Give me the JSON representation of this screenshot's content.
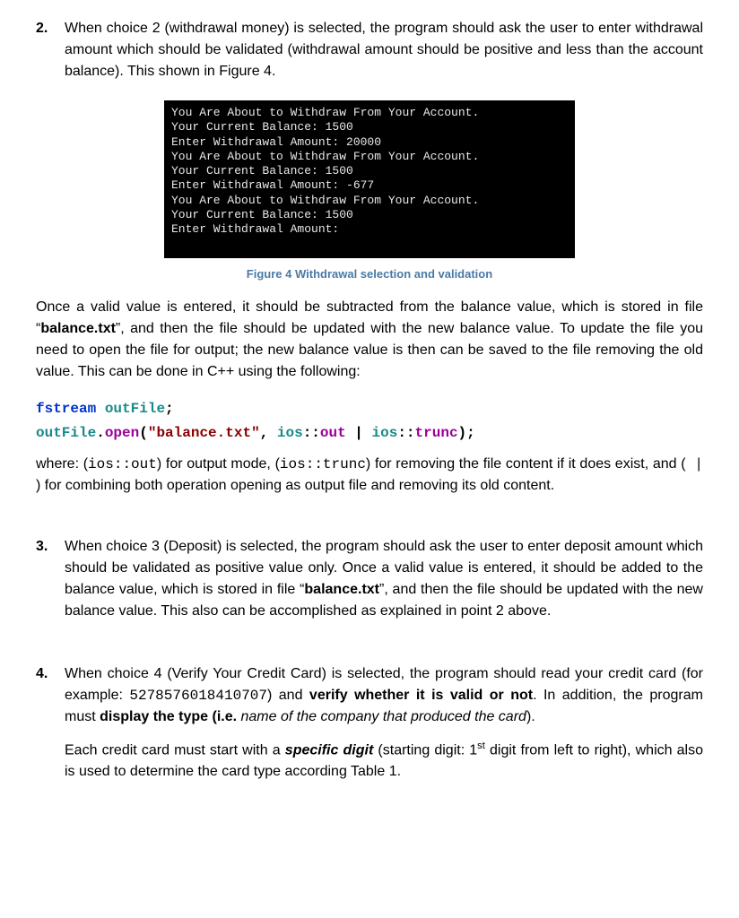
{
  "item2": {
    "num": "2.",
    "text": "When choice 2 (withdrawal money) is selected, the program should ask the user to enter withdrawal amount which should be validated (withdrawal amount should be positive and less than the account balance). This shown in Figure 4."
  },
  "terminal": {
    "l1": "You Are About to Withdraw From Your Account.",
    "l2": "Your Current Balance: 1500",
    "l3": "Enter Withdrawal Amount: 20000",
    "l4": "You Are About to Withdraw From Your Account.",
    "l5": "Your Current Balance: 1500",
    "l6": "Enter Withdrawal Amount: -677",
    "l7": "You Are About to Withdraw From Your Account.",
    "l8": "Your Current Balance: 1500",
    "l9": "Enter Withdrawal Amount:"
  },
  "figcap": "Figure 4 Withdrawal selection and validation",
  "para_once": {
    "a": "Once a valid value is entered, it should be subtracted from the balance value, which is stored in file “",
    "b_bold": "balance.txt",
    "c": "”, and then the file should be updated with the new balance value. To update the file you need to open the file for output; the new balance value is then can be saved to the file removing the old value. This can be done in C++ using the following:"
  },
  "code": {
    "l1": {
      "a": "fstream",
      "b": " ",
      "c": "outFile",
      "d": ";"
    },
    "l2": {
      "a": "outFile",
      "b": ".",
      "c": "open",
      "d": "(",
      "e": "\"balance.txt\"",
      "f": ", ",
      "g": "ios",
      "h": "::",
      "i": "out",
      "j": " | ",
      "k": "ios",
      "l": "::",
      "m": "trunc",
      "n": ");"
    }
  },
  "para_where": {
    "a": "where: (",
    "b_mono": "ios::out",
    "c": ") for output mode, (",
    "d_mono": "ios::trunc",
    "e": ") for removing the file content if it does exist, and (",
    "f_mono": " | ",
    "g": ") for combining both operation opening as output file and removing its old content."
  },
  "item3": {
    "num": "3.",
    "a": "When choice 3 (Deposit) is selected, the program should ask the user to enter deposit amount which should be validated as positive value only. Once a valid value is entered, it should be added to the balance value, which is stored in file “",
    "b_bold": "balance.txt",
    "c": "”, and then the file should be updated with the new balance value. This also can be accomplished as explained in point 2 above."
  },
  "item4": {
    "num": "4.",
    "p1": {
      "a": "When choice 4 (Verify Your Credit Card) is selected, the program should read your credit card (for example: ",
      "b_mono": "5278576018410707",
      "c": ") and ",
      "d_bold": "verify whether it is valid or not",
      "e": ". In addition, the program must ",
      "f_bold": "display the type (i.e.",
      "g_italic": " name of the company that produced the card",
      "h": ")."
    },
    "p2": {
      "a": "Each credit card must start with a ",
      "b_bi": "specific digit",
      "c": " (starting digit: 1",
      "d_sup": "st",
      "e": " digit from left to right), which also is used to determine the card type according Table 1."
    }
  }
}
